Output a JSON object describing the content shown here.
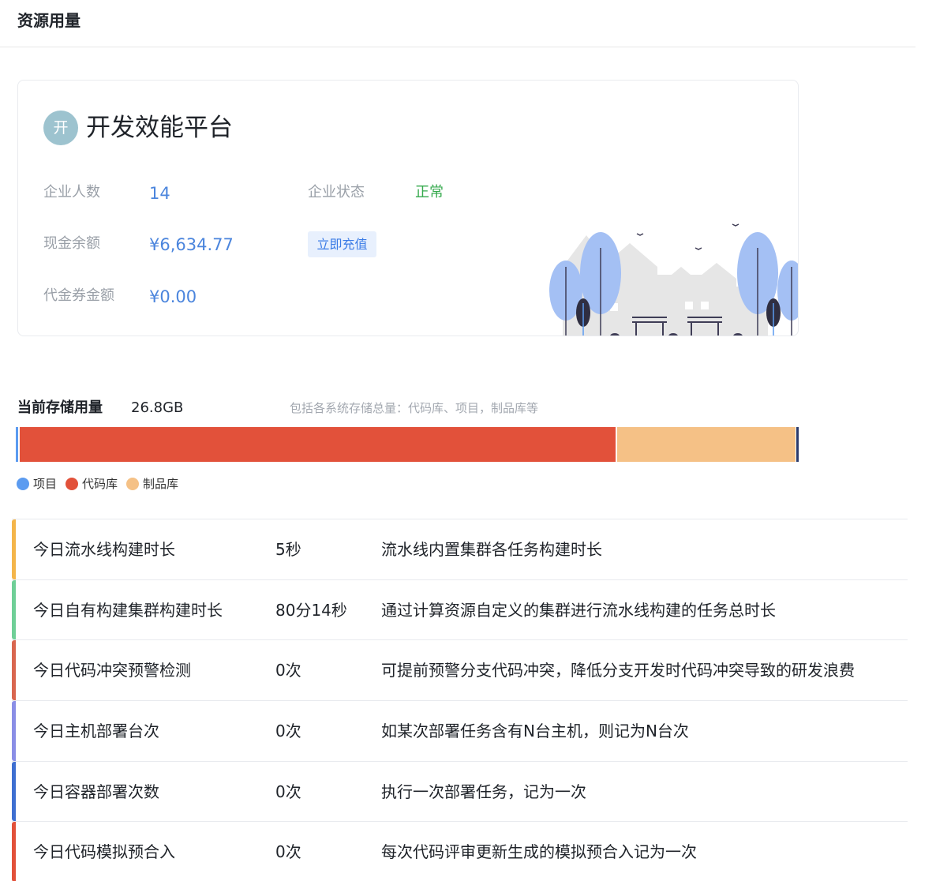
{
  "header": {
    "title": "资源用量"
  },
  "org": {
    "avatar_char": "开",
    "name": "开发效能平台",
    "members_label": "企业人数",
    "members_value": "14",
    "status_label": "企业状态",
    "status_value": "正常",
    "cash_label": "现金余额",
    "cash_value": "¥6,634.77",
    "recharge_label": "立即充值",
    "voucher_label": "代金券金额",
    "voucher_value": "¥0.00"
  },
  "storage": {
    "label": "当前存储用量",
    "value": "26.8GB",
    "note": "包括各系统存储总量：代码库、项目，制品库等",
    "legend": [
      {
        "label": "项目",
        "color": "#5b9bf0"
      },
      {
        "label": "代码库",
        "color": "#e2513a"
      },
      {
        "label": "制品库",
        "color": "#f5c186"
      }
    ]
  },
  "metrics": [
    {
      "name": "今日流水线构建时长",
      "value": "5秒",
      "desc": "流水线内置集群各任务构建时长",
      "accent": "#f4b54a"
    },
    {
      "name": "今日自有构建集群构建时长",
      "value": "80分14秒",
      "desc": "通过计算资源自定义的集群进行流水线构建的任务总时长",
      "accent": "#6fcf97"
    },
    {
      "name": "今日代码冲突预警检测",
      "value": "0次",
      "desc": "可提前预警分支代码冲突，降低分支开发时代码冲突导致的研发浪费",
      "accent": "#d9664f"
    },
    {
      "name": "今日主机部署台次",
      "value": "0次",
      "desc": "如某次部署任务含有N台主机，则记为N台次",
      "accent": "#8a8ee6"
    },
    {
      "name": "今日容器部署次数",
      "value": "0次",
      "desc": "执行一次部署任务，记为一次",
      "accent": "#3e6fd1"
    },
    {
      "name": "今日代码模拟预合入",
      "value": "0次",
      "desc": "每次代码评审更新生成的模拟预合入记为一次",
      "accent": "#e2513a"
    }
  ]
}
